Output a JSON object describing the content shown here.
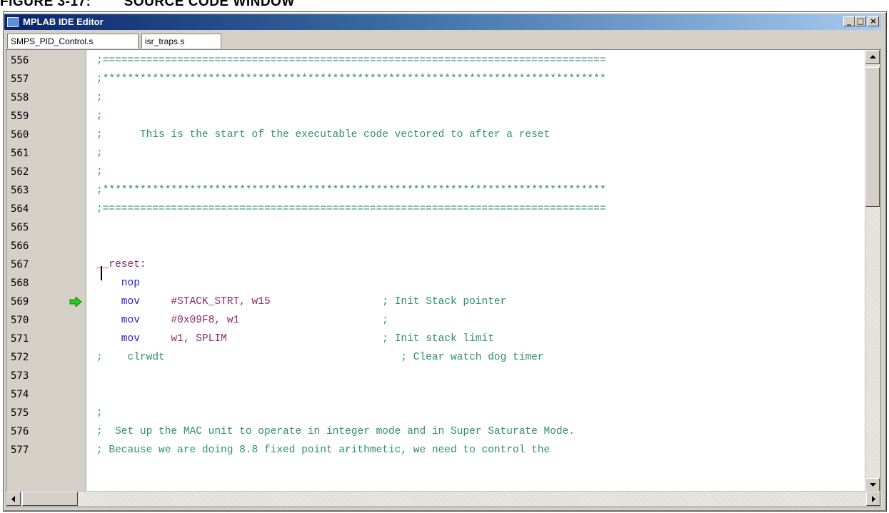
{
  "caption": "FIGURE 3-17:        SOURCE CODE WINDOW",
  "window": {
    "title": "MPLAB IDE Editor",
    "buttons": {
      "minimize": "_",
      "maximize": "□",
      "close": "×"
    }
  },
  "tabs": [
    {
      "label": "SMPS_PID_Control.s"
    },
    {
      "label": "isr_traps.s"
    }
  ],
  "editor": {
    "current_line": "569",
    "lines": [
      {
        "num": "556",
        "parts": [
          {
            "t": ";=================================================================================",
            "c": "cm"
          }
        ]
      },
      {
        "num": "557",
        "parts": [
          {
            "t": ";*********************************************************************************",
            "c": "cm"
          }
        ]
      },
      {
        "num": "558",
        "parts": [
          {
            "t": ";",
            "c": "cm"
          }
        ]
      },
      {
        "num": "559",
        "parts": [
          {
            "t": ";",
            "c": "cm"
          }
        ]
      },
      {
        "num": "560",
        "parts": [
          {
            "t": ";      This is the start of the executable code vectored to after a reset",
            "c": "cm"
          }
        ]
      },
      {
        "num": "561",
        "parts": [
          {
            "t": ";",
            "c": "cm"
          }
        ]
      },
      {
        "num": "562",
        "parts": [
          {
            "t": ";",
            "c": "cm"
          }
        ]
      },
      {
        "num": "563",
        "parts": [
          {
            "t": ";*********************************************************************************",
            "c": "cm"
          }
        ]
      },
      {
        "num": "564",
        "parts": [
          {
            "t": ";=================================================================================",
            "c": "cm"
          }
        ]
      },
      {
        "num": "565",
        "parts": []
      },
      {
        "num": "566",
        "parts": []
      },
      {
        "num": "567",
        "parts": [
          {
            "t": "__reset:",
            "c": "lbl"
          }
        ]
      },
      {
        "num": "568",
        "parts": [
          {
            "t": "    nop",
            "c": "kw"
          }
        ]
      },
      {
        "num": "569",
        "parts": [
          {
            "t": "    mov",
            "c": "kw"
          },
          {
            "t": "     #STACK_STRT, w15",
            "c": "op"
          },
          {
            "t": "                  ; Init Stack pointer",
            "c": "cm"
          }
        ]
      },
      {
        "num": "570",
        "parts": [
          {
            "t": "    mov",
            "c": "kw"
          },
          {
            "t": "     #0x09F8, w1",
            "c": "op"
          },
          {
            "t": "                       ;",
            "c": "cm"
          }
        ]
      },
      {
        "num": "571",
        "parts": [
          {
            "t": "    mov",
            "c": "kw"
          },
          {
            "t": "     w1, SPLIM",
            "c": "op"
          },
          {
            "t": "                         ; Init stack limit",
            "c": "cm"
          }
        ]
      },
      {
        "num": "572",
        "parts": [
          {
            "t": ";    clrwdt                                      ; Clear watch dog timer",
            "c": "cm"
          }
        ]
      },
      {
        "num": "573",
        "parts": []
      },
      {
        "num": "574",
        "parts": []
      },
      {
        "num": "575",
        "parts": [
          {
            "t": ";",
            "c": "cm"
          }
        ]
      },
      {
        "num": "576",
        "parts": [
          {
            "t": ";  Set up the MAC unit to operate in integer mode and in Super Saturate Mode.",
            "c": "cm"
          }
        ]
      },
      {
        "num": "577",
        "parts": [
          {
            "t": "; Because we are doing 8.8 fixed point arithmetic, we need to control the",
            "c": "cm"
          }
        ]
      }
    ]
  },
  "icons": {
    "current_line_marker": "green-arrow-icon",
    "scroll_up": "scroll-up-arrow-icon",
    "scroll_down": "scroll-down-arrow-icon",
    "scroll_left": "scroll-left-arrow-icon",
    "scroll_right": "scroll-right-arrow-icon"
  },
  "colors": {
    "comment": "#2f8f6f",
    "label": "#8b2a6e",
    "keyword": "#1f1fd0",
    "operand": "#8b2a6e",
    "titlebar": "#0a246a",
    "arrow": "#22cc22"
  }
}
